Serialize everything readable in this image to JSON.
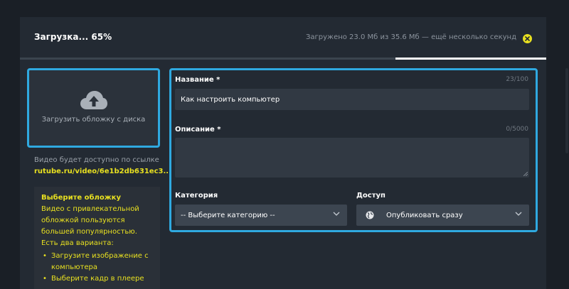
{
  "header": {
    "title": "Загрузка... 65%",
    "status": "Загружено 23.0 Мб из 35.6 Мб — ещё несколько секунд"
  },
  "progress": {
    "percent": 65
  },
  "cover": {
    "upload_label": "Загрузить обложку с диска",
    "link_note": "Видео будет доступно по ссылке",
    "link": "rutube.ru/video/6e1b2db631ec3..."
  },
  "hint": {
    "title": "Выберите обложку",
    "text": "Видео с привлекательной обложкой пользуются большей популярностью. Есть два варианта:",
    "items": [
      "Загрузите изображение с компьютера",
      "Выберите кадр в плеере"
    ]
  },
  "form": {
    "name_label": "Название *",
    "name_counter": "23/100",
    "name_value": "Как настроить компьютер",
    "desc_label": "Описание *",
    "desc_counter": "0/5000",
    "category_label": "Категория",
    "category_value": "-- Выберите категорию --",
    "access_label": "Доступ",
    "access_value": "Опубликовать сразу"
  },
  "colors": {
    "accent": "#e8e020",
    "highlight": "#2fa9e0"
  }
}
